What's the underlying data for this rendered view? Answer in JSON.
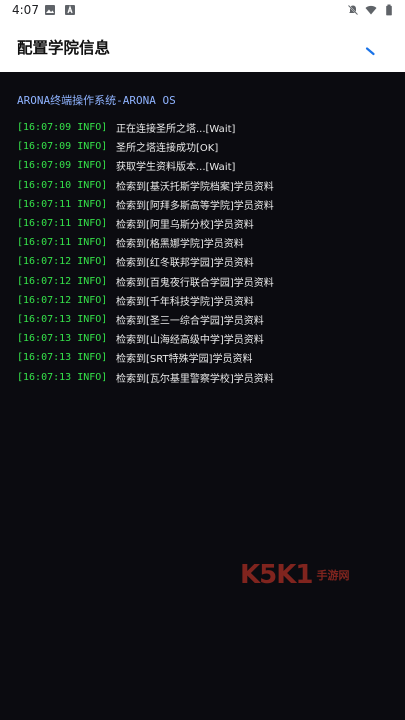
{
  "status_bar": {
    "time": "4:07",
    "icons_left": [
      "gallery-icon",
      "app-icon"
    ],
    "icons_right": [
      "mute-icon",
      "wifi-icon",
      "battery-icon"
    ]
  },
  "app_bar": {
    "title": "配置学院信息"
  },
  "terminal": {
    "system_title": "ARONA终端操作系统-ARONA OS",
    "timestamp_color": "#35e24a",
    "rows": [
      {
        "ts": "[16:07:09 INFO]",
        "msg": "正在连接圣所之塔...[Wait]"
      },
      {
        "ts": "[16:07:09 INFO]",
        "msg": "圣所之塔连接成功[OK]"
      },
      {
        "ts": "[16:07:09 INFO]",
        "msg": "获取学生资料版本...[Wait]"
      },
      {
        "ts": "[16:07:10 INFO]",
        "msg": "检索到[基沃托斯学院档案]学员资料"
      },
      {
        "ts": "[16:07:11 INFO]",
        "msg": "检索到[阿拜多斯高等学院]学员资料"
      },
      {
        "ts": "[16:07:11 INFO]",
        "msg": "检索到[阿里乌斯分校]学员资料"
      },
      {
        "ts": "[16:07:11 INFO]",
        "msg": "检索到[格黑娜学院]学员资料"
      },
      {
        "ts": "[16:07:12 INFO]",
        "msg": "检索到[红冬联邦学园]学员资料"
      },
      {
        "ts": "[16:07:12 INFO]",
        "msg": "检索到[百鬼夜行联合学园]学员资料"
      },
      {
        "ts": "[16:07:12 INFO]",
        "msg": "检索到[千年科技学院]学员资料"
      },
      {
        "ts": "[16:07:13 INFO]",
        "msg": "检索到[圣三一综合学园]学员资料"
      },
      {
        "ts": "[16:07:13 INFO]",
        "msg": "检索到[山海经高级中学]学员资料"
      },
      {
        "ts": "[16:07:13 INFO]",
        "msg": "检索到[SRT特殊学园]学员资料"
      },
      {
        "ts": "[16:07:13 INFO]",
        "msg": "检索到[瓦尔基里警察学校]学员资料"
      }
    ]
  },
  "watermark": {
    "logo": "K5K1",
    "site": "手游网"
  }
}
